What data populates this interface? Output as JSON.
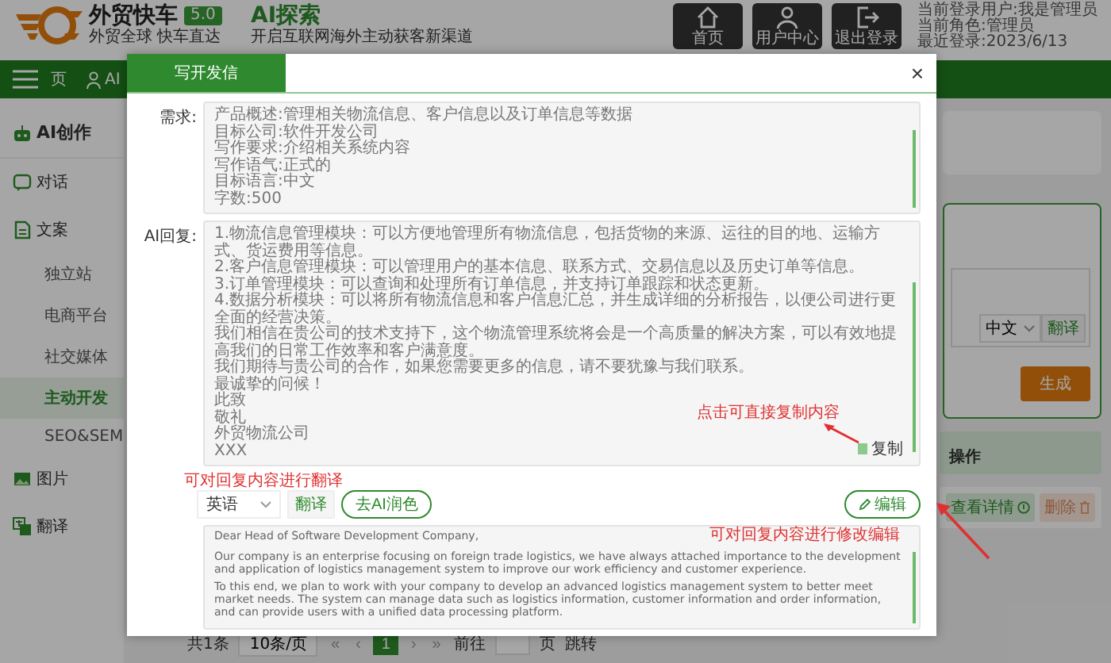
{
  "header": {
    "brand": "外贸快车",
    "version": "5.0",
    "slogan": "外贸全球 快车直达",
    "title": "AI探索",
    "subtitle": "开启互联网海外主动获客新渠道",
    "icon_buttons": [
      {
        "label": "首页",
        "kind": "home"
      },
      {
        "label": "用户中心",
        "kind": "user"
      },
      {
        "label": "退出登录",
        "kind": "logout"
      }
    ],
    "user_info": [
      "当前登录用户:我是管理员",
      "当前角色:管理员",
      "最近登录:2023/6/13"
    ]
  },
  "nav": {
    "page_tab": "页",
    "menu_item": "AI"
  },
  "sidebar": {
    "items": [
      {
        "label": "AI创作",
        "kind": "section",
        "selected": false
      },
      {
        "label": "对话",
        "kind": "chat",
        "selected": false
      },
      {
        "label": "文案",
        "kind": "doc",
        "selected": false,
        "children": [
          {
            "label": "独立站",
            "selected": false
          },
          {
            "label": "电商平台",
            "selected": false
          },
          {
            "label": "社交媒体",
            "selected": false
          },
          {
            "label": "主动开发",
            "selected": true
          },
          {
            "label": "SEO&SEM",
            "selected": false
          }
        ]
      },
      {
        "label": "图片",
        "kind": "image",
        "selected": false
      },
      {
        "label": "翻译",
        "kind": "translate",
        "selected": false
      }
    ]
  },
  "content": {
    "language_select": "中文",
    "translate_button": "翻译",
    "submit_button": "生成",
    "table": {
      "columns": [
        "操作"
      ],
      "rows": [
        {
          "actions": [
            {
              "label": "查看详情",
              "kind": "view"
            },
            {
              "label": "删除",
              "kind": "delete"
            }
          ]
        }
      ]
    },
    "pagination": {
      "total": "共1条",
      "page_size": "10条/页",
      "nav_before": [
        "«",
        "‹"
      ],
      "pages": [
        {
          "label": "1",
          "selected": true
        }
      ],
      "nav_after": [
        "›",
        "»"
      ],
      "goto_label": "前往",
      "goto_suffix": "页",
      "jump_button": "跳转"
    }
  },
  "dialog": {
    "tab": "写开发信",
    "close": "×",
    "request_label": "需求:",
    "request_lines": [
      "产品概述:管理相关物流信息、客户信息以及订单信息等数据",
      "目标公司:软件开发公司",
      "写作要求:介绍相关系统内容",
      "写作语气:正式的",
      "目标语言:中文",
      "字数:500"
    ],
    "reply_label": "AI回复:",
    "reply_lines": [
      "1.物流信息管理模块：可以方便地管理所有物流信息，包括货物的来源、运往的目的地、运输方式、货运费用等信息。",
      "2.客户信息管理模块：可以管理用户的基本信息、联系方式、交易信息以及历史订单等信息。",
      "3.订单管理模块：可以查询和处理所有订单信息，并支持订单跟踪和状态更新。",
      "4.数据分析模块：可以将所有物流信息和客户信息汇总，并生成详细的分析报告，以便公司进行更全面的经营决策。",
      "我们相信在贵公司的技术支持下，这个物流管理系统将会是一个高质量的解决方案，可以有效地提高我们的日常工作效率和客户满意度。",
      "我们期待与贵公司的合作，如果您需要更多的信息，请不要犹豫与我们联系。",
      "最诚挚的问候！",
      "此致",
      "敬礼",
      "外贸物流公司",
      "XXX"
    ],
    "copy_button": "复制",
    "language_select": "英语",
    "translate_button": "翻译",
    "polish_button": "去AI润色",
    "edit_button": "编辑",
    "translation_paragraphs": [
      "Dear Head of Software Development Company,",
      "Our company is an enterprise focusing on foreign trade logistics, we have always attached importance to the development and application of logistics management system to improve our work efficiency and customer experience.",
      "To this end, we plan to work with your company to develop an advanced logistics management system to better meet market needs. The system can manage data such as logistics information, customer information and order information, and can provide users with a unified data processing platform."
    ]
  },
  "annotations": [
    {
      "text": "点击可直接复制内容",
      "kind": "copy"
    },
    {
      "text": "可对回复内容进行翻译",
      "kind": "translate"
    },
    {
      "text": "可对回复内容进行修改编辑",
      "kind": "edit"
    }
  ]
}
